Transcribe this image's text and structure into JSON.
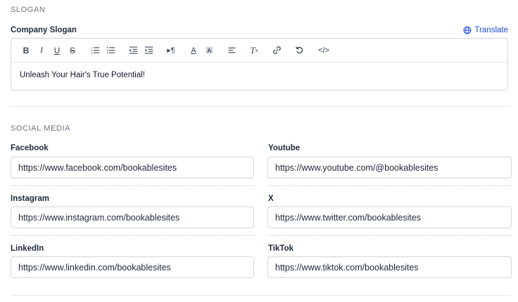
{
  "slogan_section": {
    "title": "SLOGAN",
    "field_label": "Company Slogan",
    "translate_label": "Translate",
    "content": "Unleash Your Hair's True Potential!",
    "toolbar": [
      "bold",
      "italic",
      "underline",
      "strikethrough",
      "ordered-list",
      "bullet-list",
      "outdent",
      "indent",
      "paragraph-direction",
      "text-color",
      "background-color",
      "align",
      "clear-format",
      "link",
      "undo",
      "source-code"
    ]
  },
  "social_section": {
    "title": "SOCIAL MEDIA",
    "fields": {
      "facebook": {
        "label": "Facebook",
        "value": "https://www.facebook.com/bookablesites"
      },
      "youtube": {
        "label": "Youtube",
        "value": "https://www.youtube.com/@bookablesites"
      },
      "instagram": {
        "label": "Instagram",
        "value": "https://www.instagram.com/bookablesites"
      },
      "x": {
        "label": "X",
        "value": "https://www.twitter.com/bookablesites"
      },
      "linkedin": {
        "label": "LinkedIn",
        "value": "https://www.linkedin.com/bookablesites"
      },
      "tiktok": {
        "label": "TikTok",
        "value": "https://www.tiktok.com/bookablesites"
      }
    }
  },
  "colors": {
    "link": "#1d4ed8",
    "border": "#d1d5db",
    "muted": "#6b7280"
  }
}
